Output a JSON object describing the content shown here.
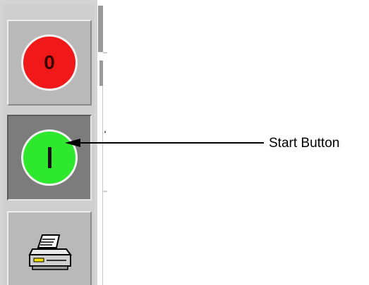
{
  "toolbar": {
    "stop_button": {
      "label": "0",
      "icon": "stop-icon",
      "color": "#f01818"
    },
    "start_button": {
      "label": "I",
      "icon": "start-icon",
      "color": "#2ee82e",
      "state": "pressed"
    },
    "print_button": {
      "icon": "printer-icon"
    }
  },
  "annotation": {
    "text": "Start Button"
  }
}
